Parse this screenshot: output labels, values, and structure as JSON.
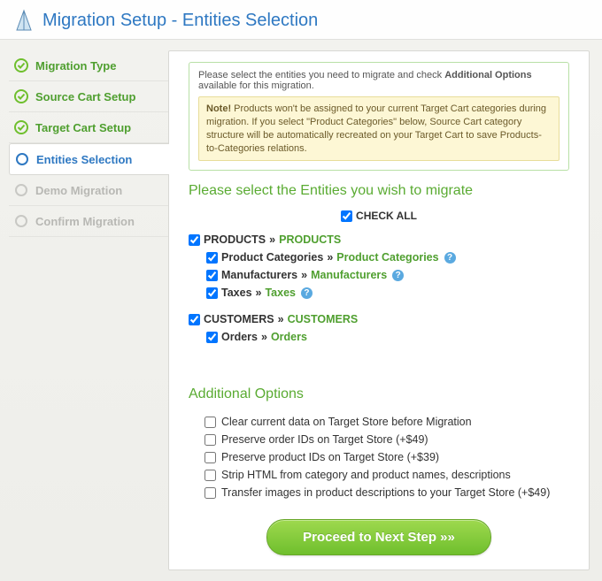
{
  "header": {
    "title": "Migration Setup - Entities Selection"
  },
  "sidebar": {
    "items": [
      {
        "label": "Migration Type",
        "state": "done"
      },
      {
        "label": "Source Cart Setup",
        "state": "done"
      },
      {
        "label": "Target Cart Setup",
        "state": "done"
      },
      {
        "label": "Entities Selection",
        "state": "active"
      },
      {
        "label": "Demo Migration",
        "state": "todo"
      },
      {
        "label": "Confirm Migration",
        "state": "todo"
      }
    ]
  },
  "info": {
    "intro_prefix": "Please select the entities you need to migrate and check ",
    "intro_bold": "Additional Options",
    "intro_suffix": " available for this migration.",
    "note_label": "Note!",
    "note_text": " Products won't be assigned to your current Target Cart categories during migration. If you select \"Product Categories\" below, Source Cart category structure will be automatically recreated on your Target Cart to save Products-to-Categories relations."
  },
  "entities": {
    "title": "Please select the Entities you wish to migrate",
    "check_all_label": "CHECK ALL",
    "groups": [
      {
        "src": "PRODUCTS",
        "tgt": "PRODUCTS",
        "checked": true,
        "children": [
          {
            "src": "Product Categories",
            "tgt": "Product Categories",
            "checked": true,
            "help": true
          },
          {
            "src": "Manufacturers",
            "tgt": "Manufacturers",
            "checked": true,
            "help": true
          },
          {
            "src": "Taxes",
            "tgt": "Taxes",
            "checked": true,
            "help": true
          }
        ]
      },
      {
        "src": "CUSTOMERS",
        "tgt": "CUSTOMERS",
        "checked": true,
        "children": [
          {
            "src": "Orders",
            "tgt": "Orders",
            "checked": true,
            "help": false
          }
        ]
      }
    ]
  },
  "options": {
    "title": "Additional Options",
    "items": [
      {
        "label": "Clear current data on Target Store before Migration",
        "checked": false
      },
      {
        "label": "Preserve order IDs on Target Store (+$49)",
        "checked": false
      },
      {
        "label": "Preserve product IDs on Target Store (+$39)",
        "checked": false
      },
      {
        "label": "Strip HTML from category and product names, descriptions",
        "checked": false
      },
      {
        "label": "Transfer images in product descriptions to your Target Store (+$49)",
        "checked": false
      }
    ]
  },
  "proceed": {
    "label": "Proceed to Next Step »»"
  }
}
